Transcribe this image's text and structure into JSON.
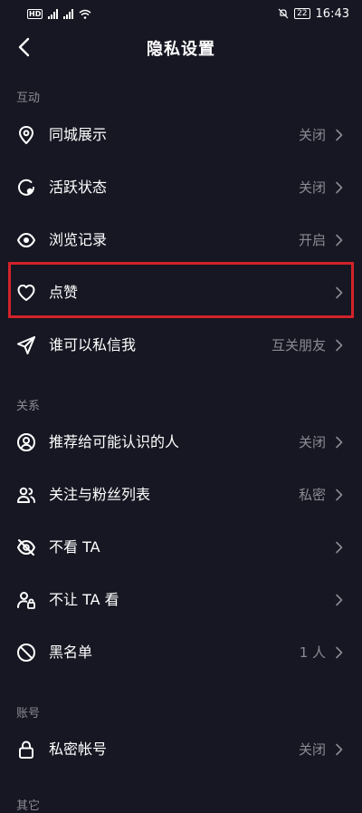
{
  "status_bar": {
    "hd": "HD",
    "net1": "4G",
    "net2": "4G",
    "battery": "22",
    "time": "16:43"
  },
  "header": {
    "title": "隐私设置"
  },
  "sections": {
    "interaction": "互动",
    "relation": "关系",
    "account": "账号",
    "partial_next": "其它"
  },
  "items": {
    "same_city": {
      "label": "同城展示",
      "value": "关闭"
    },
    "active_status": {
      "label": "活跃状态",
      "value": "关闭"
    },
    "browse_history": {
      "label": "浏览记录",
      "value": "开启"
    },
    "likes": {
      "label": "点赞",
      "value": ""
    },
    "who_dm": {
      "label": "谁可以私信我",
      "value": "互关朋友"
    },
    "recommend": {
      "label": "推荐给可能认识的人",
      "value": "关闭"
    },
    "follow_list": {
      "label": "关注与粉丝列表",
      "value": "私密"
    },
    "dont_see": {
      "label": "不看 TA",
      "value": ""
    },
    "block_see": {
      "label": "不让 TA 看",
      "value": ""
    },
    "blacklist": {
      "label": "黑名单",
      "value": "1 人"
    },
    "private_account": {
      "label": "私密帐号",
      "value": "关闭"
    }
  },
  "colors": {
    "background": "#161722",
    "text": "#ffffff",
    "secondary": "#8a8b93",
    "highlight": "#d3222a"
  }
}
